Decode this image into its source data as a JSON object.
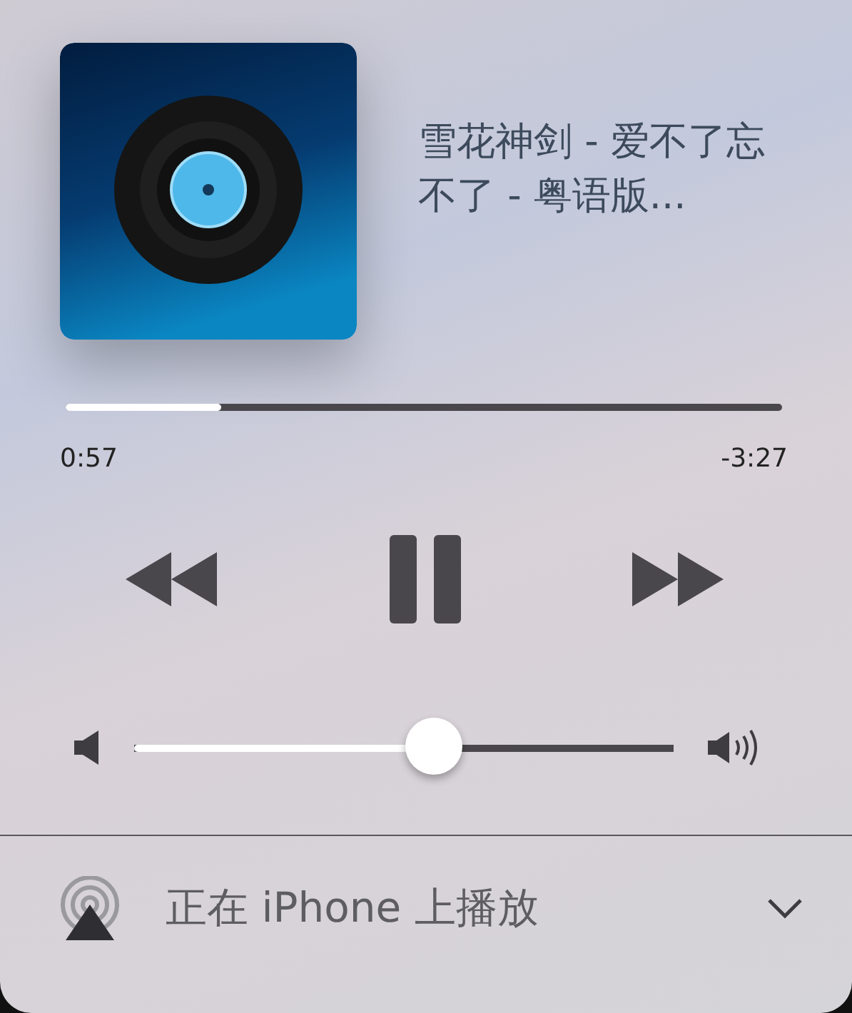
{
  "track": {
    "title": "雪花神剑 - 爱不了忘不了 - 粤语版..."
  },
  "progress": {
    "level": 0.217,
    "elapsed": "0:57",
    "remaining": "-3:27"
  },
  "transport": {
    "playing": true
  },
  "volume": {
    "level": 0.555
  },
  "output": {
    "label": "正在 iPhone 上播放"
  }
}
